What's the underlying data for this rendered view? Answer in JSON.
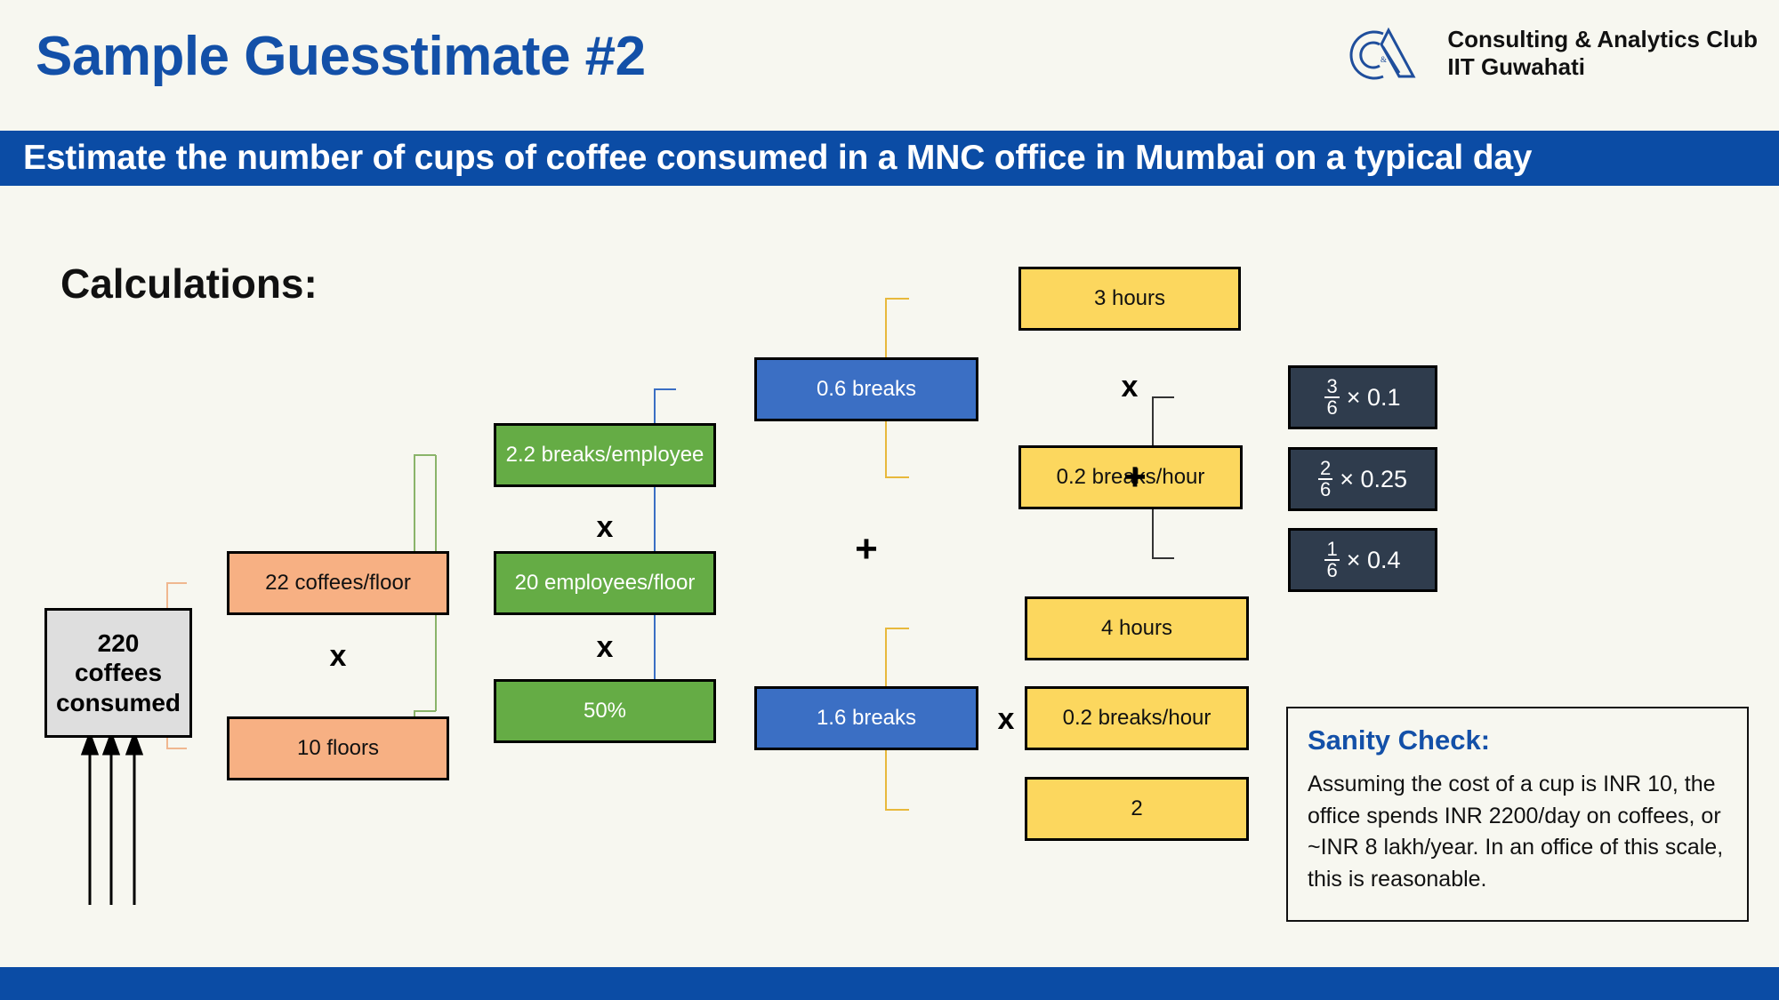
{
  "header": {
    "title": "Sample Guesstimate #2",
    "logo": {
      "icon": "ca-monogram-logo",
      "line1": "Consulting & Analytics Club",
      "line2": "IIT Guwahati"
    }
  },
  "banner": {
    "text": "Estimate the number of cups of coffee consumed in a MNC office in Mumbai on a typical day"
  },
  "section": {
    "heading": "Calculations:"
  },
  "tree": {
    "result": "220\ncoffees\nconsumed",
    "orange": [
      {
        "label": "22 coffees/floor"
      },
      {
        "label": "10 floors"
      }
    ],
    "green": [
      {
        "label": "2.2 breaks/employee"
      },
      {
        "label": "20 employees/floor"
      },
      {
        "label": "50%"
      }
    ],
    "blue": [
      {
        "label": "0.6 breaks"
      },
      {
        "label": "1.6 breaks"
      }
    ],
    "yellow_top": [
      {
        "label": "3 hours"
      },
      {
        "label": "0.2 breaks/hour"
      }
    ],
    "yellow_bottom": [
      {
        "label": "4 hours"
      },
      {
        "label": "0.2 breaks/hour"
      },
      {
        "label": "2"
      }
    ],
    "dark": [
      {
        "num": "3",
        "den": "6",
        "mult": "× 0.1"
      },
      {
        "num": "2",
        "den": "6",
        "mult": "× 0.25"
      },
      {
        "num": "1",
        "den": "6",
        "mult": "× 0.4"
      }
    ],
    "operators": {
      "mult": "x",
      "plus": "+"
    }
  },
  "sanity": {
    "title": "Sanity Check:",
    "body": "Assuming the cost of a cup is INR 10, the office spends INR 2200/day on coffees, or ~INR 8 lakh/year. In an office of this scale, this is reasonable."
  },
  "colors": {
    "brand_blue": "#0b4ca5",
    "title_blue": "#1350a8",
    "background": "#f7f7f0",
    "orange": "#f7b083",
    "green": "#65ac45",
    "blue": "#3b6fc4",
    "yellow": "#fcd75e",
    "dark": "#2f3c4d",
    "gray": "#dedede"
  }
}
